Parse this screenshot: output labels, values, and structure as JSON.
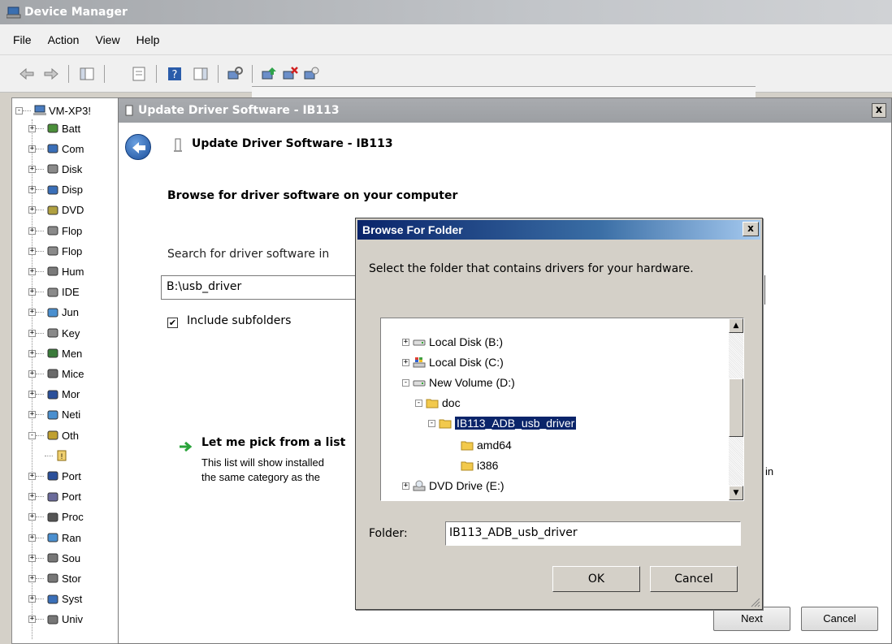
{
  "device_manager": {
    "title": "Device Manager",
    "menu": [
      "File",
      "Action",
      "View",
      "Help"
    ],
    "tree": {
      "root": "VM-XP3!",
      "items": [
        "Batt",
        "Com",
        "Disk",
        "Disp",
        "DVD",
        "Flop",
        "Flop",
        "Hum",
        "IDE",
        "Jun",
        "Key",
        "Men",
        "Mice",
        "Mor",
        "Neti",
        "Oth",
        "",
        "Port",
        "Port",
        "Proc",
        "Ran",
        "Sou",
        "Stor",
        "Syst",
        "Univ"
      ]
    }
  },
  "update_dialog": {
    "title": "Update Driver Software - IB113",
    "header": "Update Driver Software - IB113",
    "browse_heading": "Browse for driver software on your computer",
    "search_label": "Search for driver software in",
    "path_value": "B:\\usb_driver",
    "include_subfolders": {
      "label": "Include subfolders",
      "checked": true
    },
    "pick_heading": "Let me pick from a list",
    "pick_desc_line1": "This list will show installed",
    "pick_desc_line2": "the same category as the",
    "pick_desc_tail": "in",
    "next_label": "Next",
    "cancel_label": "Cancel",
    "close_glyph": "x"
  },
  "browse_folder": {
    "title": "Browse For Folder",
    "close_glyph": "x",
    "instruction": "Select the folder that contains drivers for your hardware.",
    "tree": [
      {
        "label": "Local Disk (B:)",
        "toggle": "+",
        "icon": "drive-icon"
      },
      {
        "label": "Local Disk (C:)",
        "toggle": "+",
        "icon": "windows-drive-icon"
      },
      {
        "label": "New Volume (D:)",
        "toggle": "-",
        "icon": "drive-icon"
      },
      {
        "label": "doc",
        "toggle": "-",
        "icon": "folder-icon"
      },
      {
        "label": "IB113_ADB_usb_driver",
        "toggle": "-",
        "icon": "folder-icon",
        "selected": true
      },
      {
        "label": "amd64",
        "toggle": "",
        "icon": "folder-icon"
      },
      {
        "label": "i386",
        "toggle": "",
        "icon": "folder-icon"
      },
      {
        "label": "DVD Drive (E:)",
        "toggle": "+",
        "icon": "dvd-drive-icon"
      }
    ],
    "folder_label": "Folder:",
    "folder_value": "IB113_ADB_usb_driver",
    "ok_label": "OK",
    "cancel_label": "Cancel"
  },
  "colors": {
    "selection": "#0a246a",
    "classic_face": "#d4d0c8",
    "dialog_title": "#0a246a"
  }
}
